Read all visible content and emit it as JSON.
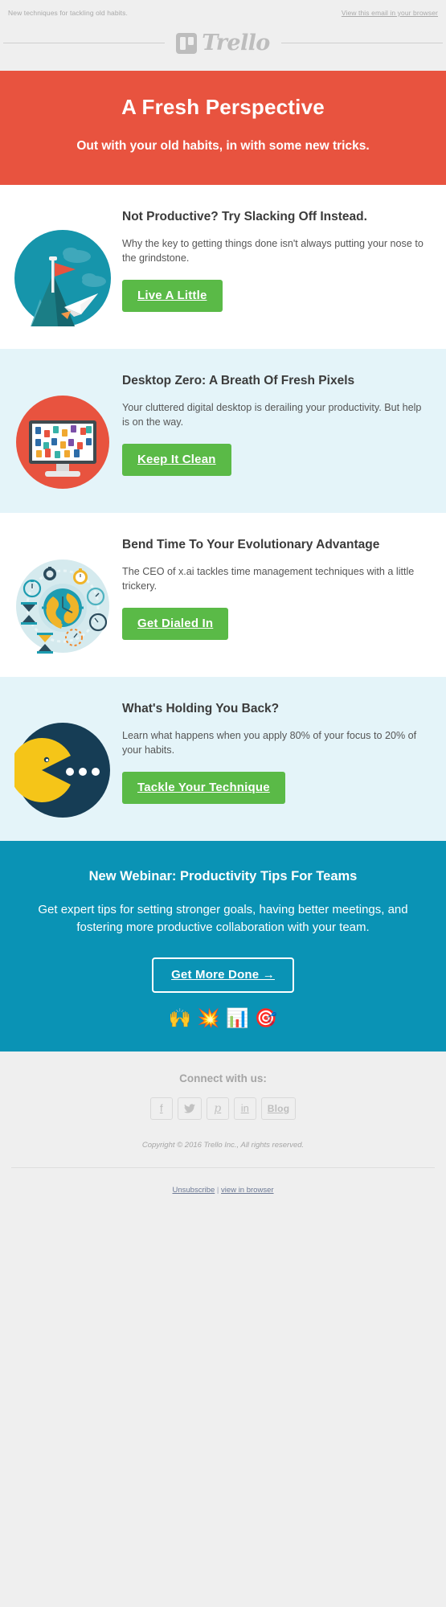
{
  "preheader": {
    "text": "New techniques for tackling old habits.",
    "browser_link": "View this email in your browser"
  },
  "brand": {
    "logo_text": "Trello",
    "logo_mark": "trello-board-icon"
  },
  "hero": {
    "headline": "A Fresh Perspective",
    "subhead": "Out with your old habits, in with some new tricks.",
    "bg_color": "#e8533f"
  },
  "articles": [
    {
      "title": "Not Productive? Try Slacking Off Instead.",
      "description": "Why the key to getting things done isn't always putting your nose to the grindstone.",
      "cta": "Live A Little",
      "illustration": "mountain-flag-paper-plane-icon",
      "background": "#ffffff"
    },
    {
      "title": "Desktop Zero: A Breath Of Fresh Pixels",
      "description": "Your cluttered digital desktop is derailing your productivity. But help is on the way.",
      "cta": "Keep It Clean",
      "illustration": "cluttered-monitor-icon",
      "background": "#e4f4f9"
    },
    {
      "title": "Bend Time To Your Evolutionary Advantage",
      "description": "The CEO of x.ai tackles time management techniques with a little trickery.",
      "cta": "Get Dialed In",
      "illustration": "globe-clocks-icon",
      "background": "#ffffff"
    },
    {
      "title": "What's Holding You Back?",
      "description": "Learn what happens when you apply 80% of your focus to 20% of your habits.",
      "cta": "Tackle Your Technique",
      "illustration": "pacman-icon",
      "background": "#e4f4f9"
    }
  ],
  "webinar": {
    "title": "New Webinar: Productivity Tips For Teams",
    "body": "Get expert tips for setting stronger goals, having better meetings, and fostering more productive collaboration with your team.",
    "cta": "Get More Done →",
    "bg_color": "#0a93b5",
    "emojis": [
      "🙌",
      "💥",
      "📊",
      "🎯"
    ]
  },
  "footer": {
    "connect_label": "Connect with us:",
    "social": [
      {
        "name": "facebook",
        "glyph": "f"
      },
      {
        "name": "twitter",
        "glyph": "ᴠ"
      },
      {
        "name": "pinterest",
        "glyph": "℗"
      },
      {
        "name": "linkedin",
        "glyph": "in"
      },
      {
        "name": "blog",
        "glyph": "Blog"
      }
    ],
    "copyright": "Copyright © 2016 Trello Inc., All rights reserved.",
    "unsubscribe": "Unsubscribe",
    "separator": " | ",
    "view_in_browser": "view in browser"
  },
  "colors": {
    "green_cta": "#5aba47",
    "hero_red": "#e8533f",
    "ice_blue": "#e4f4f9",
    "teal": "#0a93b5",
    "page_gray": "#efefef"
  }
}
